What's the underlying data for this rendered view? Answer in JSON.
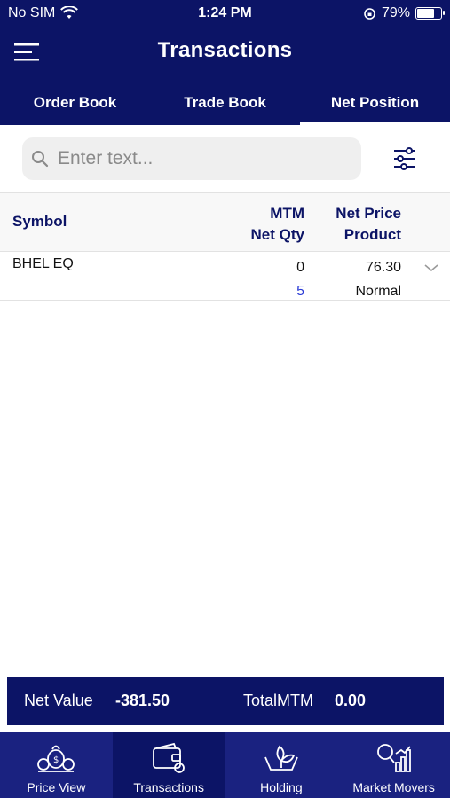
{
  "status_bar": {
    "carrier": "No SIM",
    "time": "1:24 PM",
    "battery_percent": "79%",
    "battery_level": 0.79
  },
  "header": {
    "title": "Transactions"
  },
  "tabs": [
    {
      "label": "Order Book",
      "active": false
    },
    {
      "label": "Trade Book",
      "active": false
    },
    {
      "label": "Net Position",
      "active": true
    }
  ],
  "search": {
    "placeholder": "Enter text...",
    "value": ""
  },
  "table": {
    "columns": {
      "symbol": "Symbol",
      "mtm": "MTM",
      "net_qty": "Net Qty",
      "net_price": "Net Price",
      "product": "Product"
    },
    "rows": [
      {
        "symbol": "BHEL EQ",
        "mtm": "0",
        "net_qty": "5",
        "net_price": "76.30",
        "product": "Normal"
      }
    ]
  },
  "summary": {
    "net_value_label": "Net Value",
    "net_value": "-381.50",
    "total_mtm_label": "TotalMTM",
    "total_mtm": "0.00"
  },
  "bottom_nav": [
    {
      "label": "Price View",
      "icon": "price-view-icon"
    },
    {
      "label": "Transactions",
      "icon": "transactions-icon",
      "active": true
    },
    {
      "label": "Holding",
      "icon": "holding-icon"
    },
    {
      "label": "Market Movers",
      "icon": "market-movers-icon"
    }
  ],
  "colors": {
    "primary": "#0c1466",
    "nav_bg": "#1a2280",
    "qty_blue": "#2a3bd6"
  }
}
